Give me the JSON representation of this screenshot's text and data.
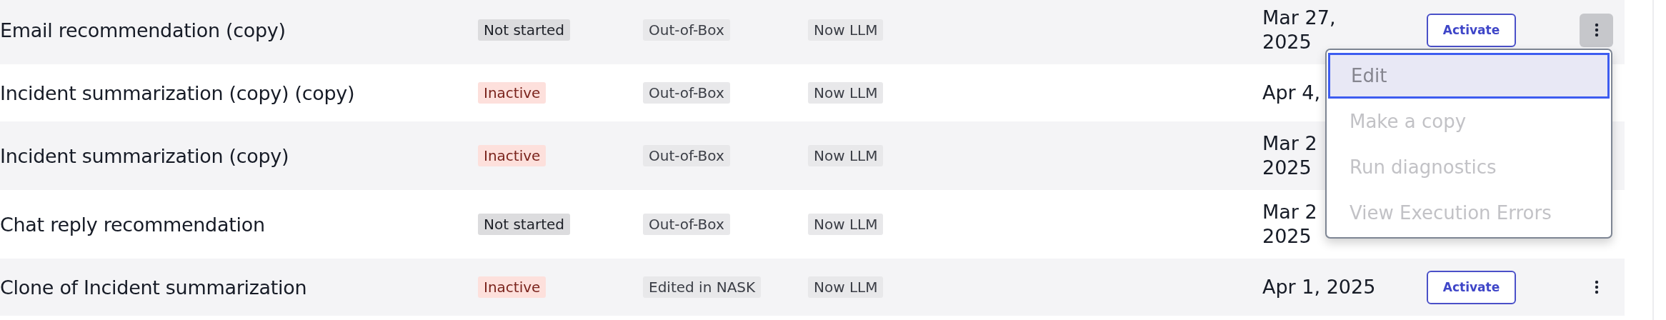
{
  "rows": [
    {
      "name": "Email recommendation (copy)",
      "status": {
        "label": "Not started",
        "kind": "neutral"
      },
      "source": "Out-of-Box",
      "model": "Now LLM",
      "date": [
        "Mar 27,",
        "2025"
      ],
      "action": "Activate",
      "more": {
        "selected": true
      }
    },
    {
      "name": "Incident summarization (copy) (copy)",
      "status": {
        "label": "Inactive",
        "kind": "inactive"
      },
      "source": "Out-of-Box",
      "model": "Now LLM",
      "date": [
        "Apr 4,"
      ]
    },
    {
      "name": "Incident summarization (copy)",
      "status": {
        "label": "Inactive",
        "kind": "inactive"
      },
      "source": "Out-of-Box",
      "model": "Now LLM",
      "date": [
        "Mar 2",
        "2025"
      ]
    },
    {
      "name": "Chat reply recommendation",
      "status": {
        "label": "Not started",
        "kind": "neutral"
      },
      "source": "Out-of-Box",
      "model": "Now LLM",
      "date": [
        "Mar 2",
        "2025"
      ]
    },
    {
      "name": "Clone of Incident summarization",
      "status": {
        "label": "Inactive",
        "kind": "inactive"
      },
      "source": "Edited in NASK",
      "model": "Now LLM",
      "date": [
        "Apr 1, 2025"
      ],
      "action": "Activate",
      "more": {
        "selected": false
      }
    }
  ],
  "menu": {
    "items": [
      {
        "label": "Edit",
        "selected": true,
        "disabled": true
      },
      {
        "label": "Make a copy",
        "selected": false,
        "disabled": true
      },
      {
        "label": "Run diagnostics",
        "selected": false,
        "disabled": true
      },
      {
        "label": "View Execution Errors",
        "selected": false,
        "disabled": true
      }
    ]
  }
}
